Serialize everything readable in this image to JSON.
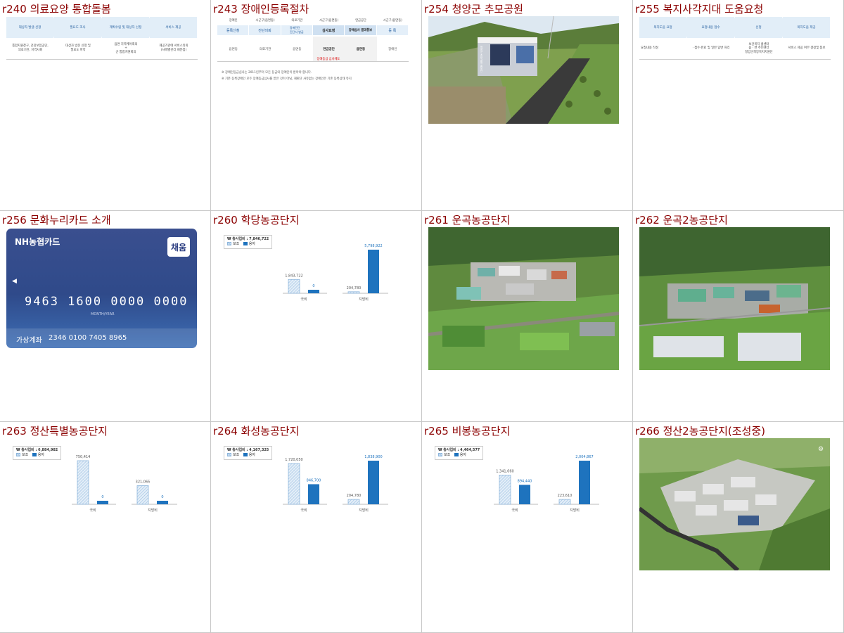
{
  "cells": [
    {
      "id": "r240",
      "title": "r240 의료요양 통합돌봄",
      "kind": "flow4",
      "flow": {
        "steps": [
          "대상자 발굴·신청",
          "필요도 조사",
          "계획수립 및 대상자 선정",
          "서비스 제공"
        ],
        "descs": [
          "통합지원창구, 건강보험공단,\n의료기관, 지역사회",
          "대상자 방문 신청 및\n필요도 파악",
          "읍면 지역케어회의\n+\n군 통합지원회의",
          "제공기관에 서비스의뢰\n(사례별관리 때분점)"
        ]
      }
    },
    {
      "id": "r243",
      "title": "r243 장애인등록절차",
      "kind": "registration",
      "reg": {
        "top": [
          "장애인",
          "시군구(읍면동)",
          "의료기관",
          "시군구(읍면동)",
          "연금공단",
          "시군구(읍면동)"
        ],
        "steps": [
          "등록신청",
          "진단의뢰",
          "장애진단\n진단서 발급",
          "심사요청",
          "장애심사 결과통보",
          "등 록"
        ],
        "who": [
          "읍면동",
          "의료기관",
          "읍면동",
          "연금공단",
          "읍면동",
          "장애인"
        ],
        "red": "장애등급 심사제도",
        "notes": [
          "※ 장애인등급심사는 2011년부터 모든 등급의 장애인이 받아야 합니다.",
          "※ 기존 등록장애인 모두 장애등급심사를 받은 것이 아님, 재판단 사유없는 장애인은 기존 등록상태 유지"
        ]
      }
    },
    {
      "id": "r254",
      "title": "r254 청양군 추모공원",
      "kind": "photo",
      "photo": "memorial-park-photo",
      "sign": "청양군 추모공원 홍보관"
    },
    {
      "id": "r255",
      "title": "r255 복지사각지대 도움요청",
      "kind": "flow4",
      "flow": {
        "steps": [
          "복지도움 요청",
          "요청내용 접수",
          "선정",
          "복지도움 제공"
        ],
        "descs": [
          "요청내용 작성",
          "· 접수·완료 및 일반 답변 처리",
          "보건복지 콜센터\n읍 · 면 주민센터\n청양군희망복지지원단",
          "서비스 제공 여부 결정및 통보"
        ]
      }
    },
    {
      "id": "r256",
      "title": "r256 문화누리카드 소개",
      "kind": "card",
      "card": {
        "brand": "NH농협카드",
        "badge": "채움",
        "number": "9463 1600 0000 0000",
        "month_year": "MONTH/YEAR",
        "acct_label": "가상계좌",
        "acct_number": "2346 0100 7405 8965"
      }
    },
    {
      "id": "r260",
      "title": "r260 학당농공단지",
      "kind": "chart"
    },
    {
      "id": "r261",
      "title": "r261 운곡농공단지",
      "kind": "photo",
      "photo": "industrial-complex-aerial-photo"
    },
    {
      "id": "r262",
      "title": "r262 운곡2농공단지",
      "kind": "photo",
      "photo": "industrial-complex-aerial-photo"
    },
    {
      "id": "r263",
      "title": "r263 정산특별농공단지",
      "kind": "chart"
    },
    {
      "id": "r264",
      "title": "r264 화성농공단지",
      "kind": "chart"
    },
    {
      "id": "r265",
      "title": "r265 비봉농공단지",
      "kind": "chart"
    },
    {
      "id": "r266",
      "title": "r266 정산2농공단지(조성중)",
      "kind": "photo",
      "photo": "industrial-complex-rendering"
    }
  ],
  "legend": {
    "hatch": "보조",
    "solid": "융자"
  },
  "chart_data": [
    {
      "type": "bar",
      "cell": "r260",
      "total_label": "₩ 총사업비 : 7,846,722",
      "categories": [
        "국비",
        "지방비"
      ],
      "series": [
        {
          "name": "보조",
          "values": [
            1843722,
            204780
          ]
        },
        {
          "name": "융자",
          "values": [
            0,
            5798922
          ]
        }
      ],
      "labels": [
        [
          "1,843,722",
          "204,780"
        ],
        [
          "0",
          "5,798,922"
        ]
      ]
    },
    {
      "type": "bar",
      "cell": "r263",
      "total_label": "₩ 총사업비 : 6,884,982",
      "categories": [
        "국비",
        "지방비"
      ],
      "series": [
        {
          "name": "보조",
          "values": [
            750414,
            321065
          ]
        },
        {
          "name": "융자",
          "values": [
            0,
            0
          ]
        }
      ],
      "labels": [
        [
          "750,414",
          "321,065"
        ],
        [
          "0",
          "0"
        ]
      ]
    },
    {
      "type": "bar",
      "cell": "r264",
      "total_label": "₩ 총사업비 : 4,167,325",
      "categories": [
        "국비",
        "지방비"
      ],
      "series": [
        {
          "name": "보조",
          "values": [
            1720050,
            204780
          ]
        },
        {
          "name": "융자",
          "values": [
            846700,
            1838900
          ]
        }
      ],
      "labels": [
        [
          "1,720,050",
          "204,780"
        ],
        [
          "846,700",
          "1,838,900"
        ]
      ]
    },
    {
      "type": "bar",
      "cell": "r265",
      "total_label": "₩ 총사업비 : 4,464,577",
      "categories": [
        "국비",
        "지방비"
      ],
      "series": [
        {
          "name": "보조",
          "values": [
            1341660,
            223610
          ]
        },
        {
          "name": "융자",
          "values": [
            894440,
            2004867
          ]
        }
      ],
      "labels": [
        [
          "1,341,660",
          "223,610"
        ],
        [
          "894,440",
          "2,004,867"
        ]
      ]
    }
  ],
  "colors": {
    "title": "#8b0000",
    "bar_solid": "#1e73be",
    "bar_hatch": "#8fb7dd",
    "label": "#1e73be"
  }
}
